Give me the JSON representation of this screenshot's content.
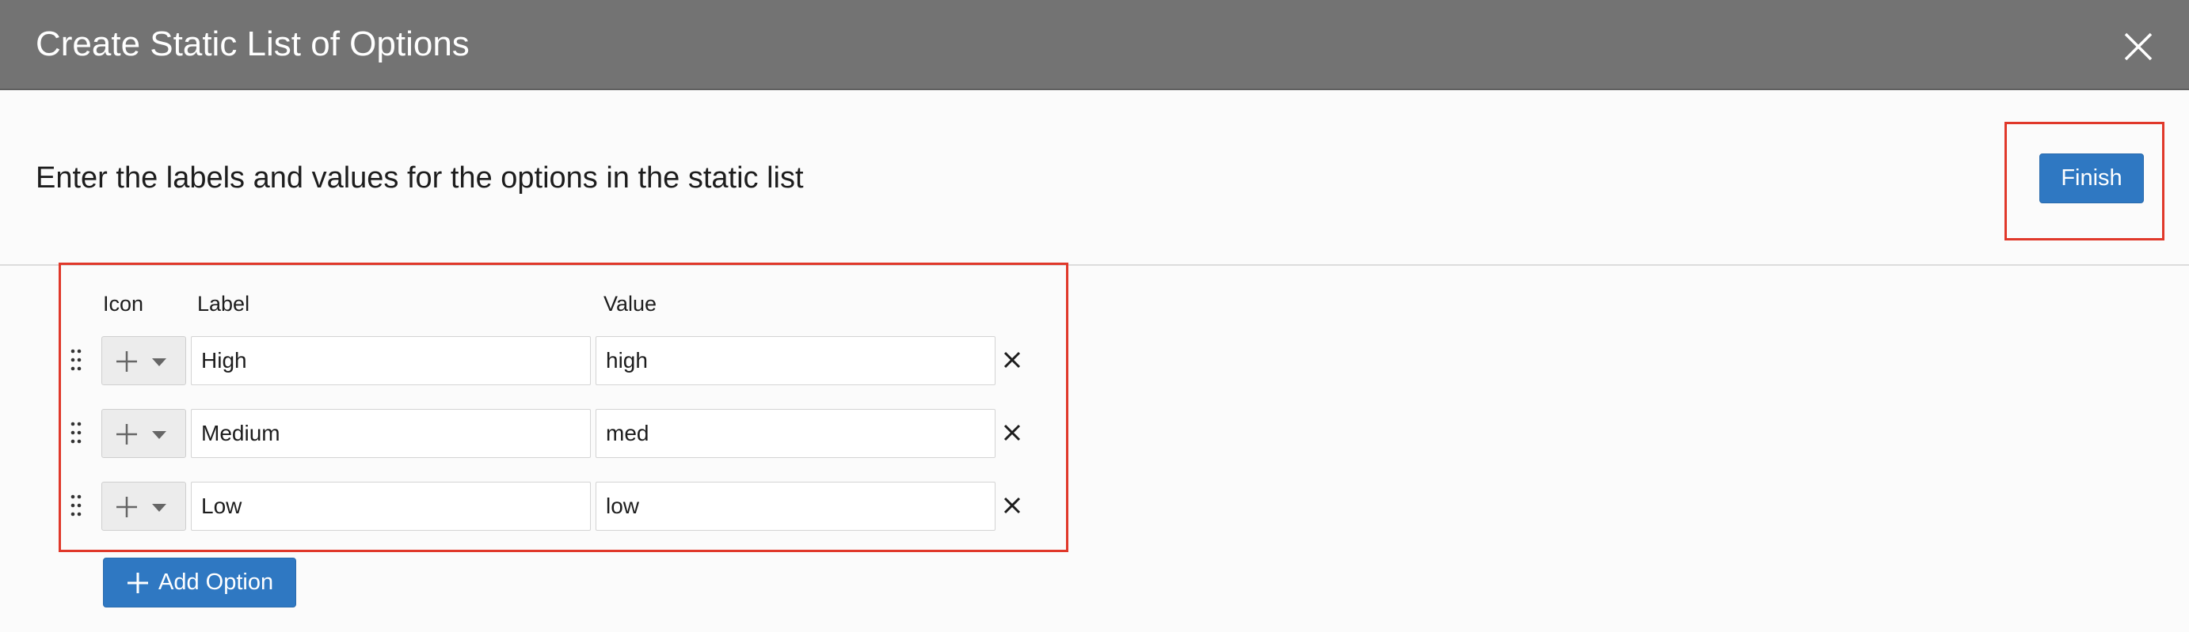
{
  "dialog": {
    "title": "Create Static List of Options",
    "close_icon": "close-icon"
  },
  "header": {
    "instructions": "Enter the labels and values for the options in the static list",
    "finish_label": "Finish"
  },
  "columns": {
    "icon": "Icon",
    "label": "Label",
    "value": "Value"
  },
  "options": [
    {
      "icon": "plus-icon",
      "label": "High",
      "value": "high"
    },
    {
      "icon": "plus-icon",
      "label": "Medium",
      "value": "med"
    },
    {
      "icon": "plus-icon",
      "label": "Low",
      "value": "low"
    }
  ],
  "add_option_label": "Add Option",
  "colors": {
    "title_bar": "#737373",
    "primary_button": "#2f78c2",
    "highlight": "#e0382a"
  }
}
